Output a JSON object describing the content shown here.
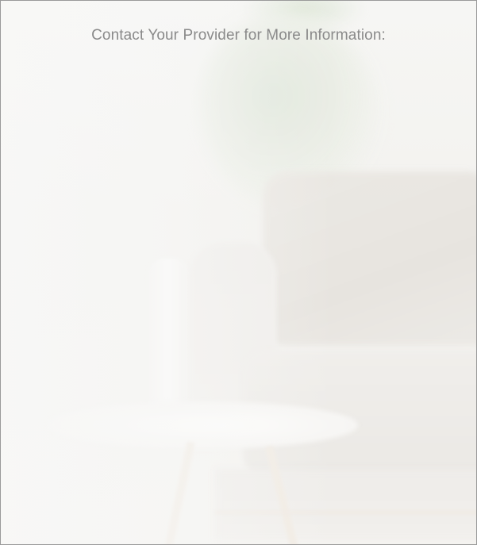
{
  "header": {
    "text": "Contact Your Provider for More Information:"
  },
  "background": {
    "description_icon": "living-room-background-image"
  },
  "colors": {
    "text": "#8a8a8a",
    "border": "#9a9a9a"
  }
}
